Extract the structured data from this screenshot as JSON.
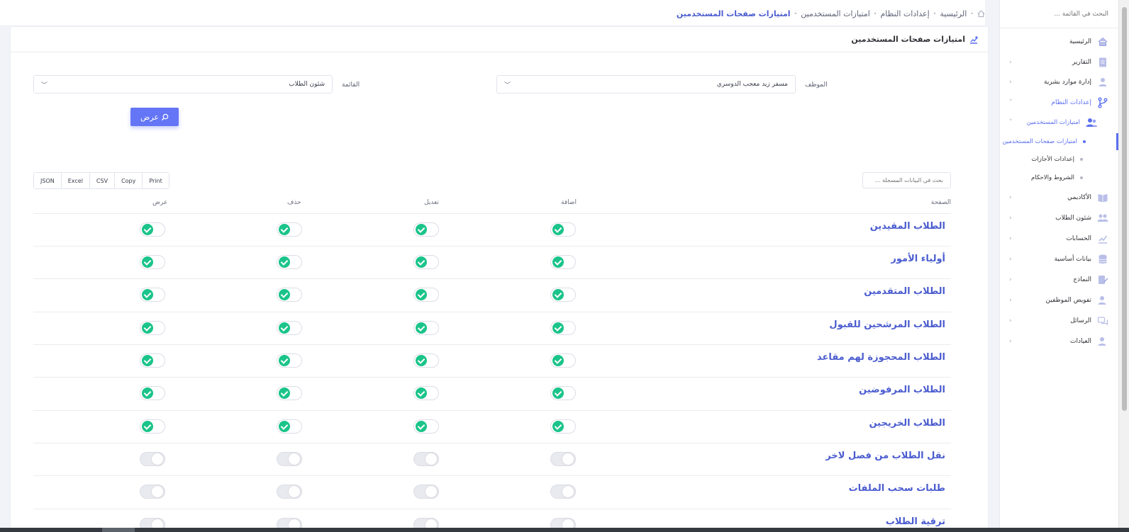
{
  "breadcrumb": {
    "items": [
      "الرئيسية",
      "إعدادات النظام",
      "امتيازات المستخدمين",
      "امتيازات صفحات المستخدمين"
    ]
  },
  "sidebar": {
    "search_placeholder": "البحث في القائمة ...",
    "items": [
      {
        "label": "الرئيسية",
        "icon": "home-icon",
        "arrow": ""
      },
      {
        "label": "التقارير",
        "icon": "report-icon",
        "arrow": "‹"
      },
      {
        "label": "إدارة موارد بشرية",
        "icon": "user-icon",
        "arrow": "‹"
      },
      {
        "label": "إعدادات النظام",
        "icon": "branch-icon",
        "arrow": "˅"
      },
      {
        "label": "امتيازات المستخدمين",
        "icon": "users-icon",
        "arrow": "˅"
      },
      {
        "label": "امتيازات صفحات المستخدمين",
        "icon": "",
        "arrow": ""
      },
      {
        "label": "إعدادات الأجازات",
        "icon": "",
        "arrow": ""
      },
      {
        "label": "الشروط والاحكام",
        "icon": "",
        "arrow": ""
      },
      {
        "label": "الأكاديمي",
        "icon": "book-icon",
        "arrow": "‹"
      },
      {
        "label": "شئون الطلاب",
        "icon": "students-icon",
        "arrow": "‹"
      },
      {
        "label": "الحسابات",
        "icon": "chart-icon",
        "arrow": "‹"
      },
      {
        "label": "بيانات أساسية",
        "icon": "database-icon",
        "arrow": "‹"
      },
      {
        "label": "النماذج",
        "icon": "forms-icon",
        "arrow": "‹"
      },
      {
        "label": "تفويض الموظفين",
        "icon": "user-delegate-icon",
        "arrow": "‹"
      },
      {
        "label": "الرسائل",
        "icon": "chat-icon",
        "arrow": "‹"
      },
      {
        "label": "العيادات",
        "icon": "clinic-icon",
        "arrow": "‹"
      }
    ]
  },
  "card": {
    "title": "امتيازات صفحات المستخدمين",
    "employee_label": "الموظف",
    "employee_value": "مسفر زيد معجب الدوسري",
    "menu_label": "القائمة",
    "menu_value": "شئون الطلاب",
    "show_button": "عرض"
  },
  "export_buttons": [
    "JSON",
    "Excel",
    "CSV",
    "Copy",
    "Print"
  ],
  "table_search_placeholder": "بحث في البيانات المسجلة ...",
  "table": {
    "headers": {
      "page": "الصفحة",
      "add": "اضافة",
      "edit": "تعديل",
      "delete": "حذف",
      "view": "عرض"
    },
    "rows": [
      {
        "page": "الطلاب المقيدين",
        "add": true,
        "edit": true,
        "delete": true,
        "view": true
      },
      {
        "page": "أولياء الأمور",
        "add": true,
        "edit": true,
        "delete": true,
        "view": true
      },
      {
        "page": "الطلاب المتقدمين",
        "add": true,
        "edit": true,
        "delete": true,
        "view": true
      },
      {
        "page": "الطلاب المرشحين للقبول",
        "add": true,
        "edit": true,
        "delete": true,
        "view": true
      },
      {
        "page": "الطلاب المحجوزة لهم مقاعد",
        "add": true,
        "edit": true,
        "delete": true,
        "view": true
      },
      {
        "page": "الطلاب المرفوضين",
        "add": true,
        "edit": true,
        "delete": true,
        "view": true
      },
      {
        "page": "الطلاب الخريجين",
        "add": true,
        "edit": true,
        "delete": true,
        "view": true
      },
      {
        "page": "نقل الطلاب من فصل لاخر",
        "add": false,
        "edit": false,
        "delete": false,
        "view": false
      },
      {
        "page": "طلبات سحب الملفات",
        "add": false,
        "edit": false,
        "delete": false,
        "view": false
      },
      {
        "page": "ترقية الطلاب",
        "add": false,
        "edit": false,
        "delete": false,
        "view": false
      }
    ]
  },
  "colors": {
    "accent": "#5a6ff0",
    "toggle_on": "#1bc48a",
    "button": "#6476f5"
  }
}
